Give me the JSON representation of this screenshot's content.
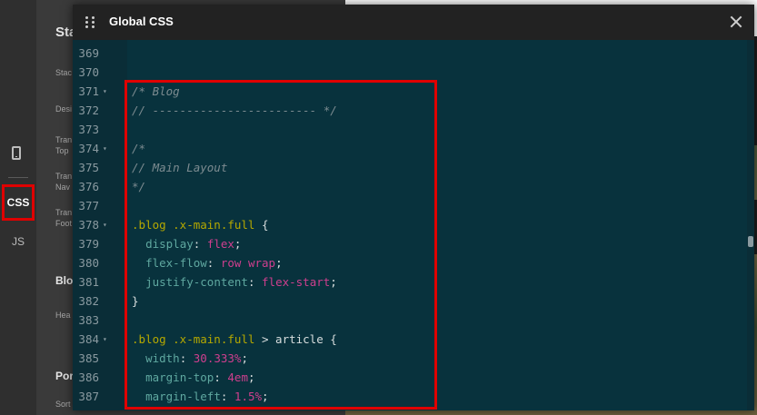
{
  "rail": {
    "icons": [
      "mobile-icon"
    ],
    "css_label": "CSS",
    "js_label": "JS"
  },
  "panel": {
    "title": "Sta",
    "sections": [
      {
        "label": "Stac"
      },
      {
        "label": "Desi"
      },
      {
        "label": "Tran\nTop"
      },
      {
        "label": "Tran\nNav"
      },
      {
        "label": "Tran\nFoot"
      },
      {
        "label": "Blo",
        "heading": true
      },
      {
        "label": "Hea"
      },
      {
        "label": "Por",
        "heading": true
      },
      {
        "label": "Sort"
      }
    ]
  },
  "modal": {
    "title": "Global CSS",
    "drag_icon": "drag-handle-icon",
    "close_icon": "close-icon"
  },
  "editor": {
    "lines": [
      {
        "num": "369",
        "fold": false,
        "tokens": []
      },
      {
        "num": "370",
        "fold": false,
        "tokens": []
      },
      {
        "num": "371",
        "fold": true,
        "tokens": [
          {
            "t": "comment",
            "v": "/* Blog"
          }
        ]
      },
      {
        "num": "372",
        "fold": false,
        "tokens": [
          {
            "t": "comment",
            "v": "// ------------------------ */"
          }
        ]
      },
      {
        "num": "373",
        "fold": false,
        "tokens": []
      },
      {
        "num": "374",
        "fold": true,
        "tokens": [
          {
            "t": "comment",
            "v": "/*"
          }
        ]
      },
      {
        "num": "375",
        "fold": false,
        "tokens": [
          {
            "t": "comment",
            "v": "// Main Layout"
          }
        ]
      },
      {
        "num": "376",
        "fold": false,
        "tokens": [
          {
            "t": "comment",
            "v": "*/"
          }
        ]
      },
      {
        "num": "377",
        "fold": false,
        "tokens": []
      },
      {
        "num": "378",
        "fold": true,
        "tokens": [
          {
            "t": "selector",
            "v": ".blog .x-main.full"
          },
          {
            "t": "plain",
            "v": " {"
          }
        ]
      },
      {
        "num": "379",
        "fold": false,
        "tokens": [
          {
            "t": "plain",
            "v": "  "
          },
          {
            "t": "prop",
            "v": "display"
          },
          {
            "t": "plain",
            "v": ": "
          },
          {
            "t": "val",
            "v": "flex"
          },
          {
            "t": "plain",
            "v": ";"
          }
        ]
      },
      {
        "num": "380",
        "fold": false,
        "tokens": [
          {
            "t": "plain",
            "v": "  "
          },
          {
            "t": "prop",
            "v": "flex-flow"
          },
          {
            "t": "plain",
            "v": ": "
          },
          {
            "t": "val",
            "v": "row wrap"
          },
          {
            "t": "plain",
            "v": ";"
          }
        ]
      },
      {
        "num": "381",
        "fold": false,
        "tokens": [
          {
            "t": "plain",
            "v": "  "
          },
          {
            "t": "prop",
            "v": "justify-content"
          },
          {
            "t": "plain",
            "v": ": "
          },
          {
            "t": "val",
            "v": "flex-start"
          },
          {
            "t": "plain",
            "v": ";"
          }
        ]
      },
      {
        "num": "382",
        "fold": false,
        "tokens": [
          {
            "t": "plain",
            "v": "}"
          }
        ]
      },
      {
        "num": "383",
        "fold": false,
        "tokens": []
      },
      {
        "num": "384",
        "fold": true,
        "tokens": [
          {
            "t": "selector",
            "v": ".blog .x-main.full"
          },
          {
            "t": "plain",
            "v": " > article {"
          }
        ]
      },
      {
        "num": "385",
        "fold": false,
        "tokens": [
          {
            "t": "plain",
            "v": "  "
          },
          {
            "t": "prop",
            "v": "width"
          },
          {
            "t": "plain",
            "v": ": "
          },
          {
            "t": "val",
            "v": "30.333%"
          },
          {
            "t": "plain",
            "v": ";"
          }
        ]
      },
      {
        "num": "386",
        "fold": false,
        "tokens": [
          {
            "t": "plain",
            "v": "  "
          },
          {
            "t": "prop",
            "v": "margin-top"
          },
          {
            "t": "plain",
            "v": ": "
          },
          {
            "t": "val",
            "v": "4em"
          },
          {
            "t": "plain",
            "v": ";"
          }
        ]
      },
      {
        "num": "387",
        "fold": false,
        "tokens": [
          {
            "t": "plain",
            "v": "  "
          },
          {
            "t": "prop",
            "v": "margin-left"
          },
          {
            "t": "plain",
            "v": ": "
          },
          {
            "t": "val",
            "v": "1.5%"
          },
          {
            "t": "plain",
            "v": ";"
          }
        ]
      }
    ]
  },
  "colors": {
    "highlight": "#e00000",
    "editor_bg": "#08323d",
    "comment": "#7c8b90",
    "selector": "#b5a800",
    "property": "#5fa8a0",
    "value": "#cf3f8e"
  }
}
